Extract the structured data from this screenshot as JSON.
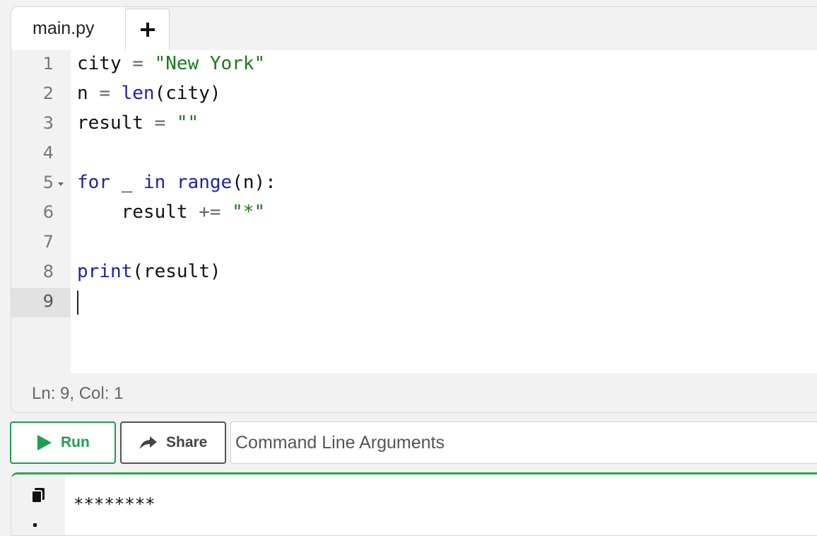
{
  "tabs": {
    "file_label": "main.py",
    "add_label": "+"
  },
  "editor": {
    "lines": [
      {
        "num": "1",
        "tokens": [
          {
            "t": "city ",
            "c": ""
          },
          {
            "t": "=",
            "c": "op"
          },
          {
            "t": " ",
            "c": ""
          },
          {
            "t": "\"New York\"",
            "c": "str"
          }
        ]
      },
      {
        "num": "2",
        "tokens": [
          {
            "t": "n ",
            "c": ""
          },
          {
            "t": "=",
            "c": "op"
          },
          {
            "t": " ",
            "c": ""
          },
          {
            "t": "len",
            "c": "fn"
          },
          {
            "t": "(city)",
            "c": ""
          }
        ]
      },
      {
        "num": "3",
        "tokens": [
          {
            "t": "result ",
            "c": ""
          },
          {
            "t": "=",
            "c": "op"
          },
          {
            "t": " ",
            "c": ""
          },
          {
            "t": "\"\"",
            "c": "str"
          }
        ]
      },
      {
        "num": "4",
        "tokens": []
      },
      {
        "num": "5",
        "fold": true,
        "tokens": [
          {
            "t": "for",
            "c": "kw"
          },
          {
            "t": " _ ",
            "c": ""
          },
          {
            "t": "in",
            "c": "kw"
          },
          {
            "t": " ",
            "c": ""
          },
          {
            "t": "range",
            "c": "fn"
          },
          {
            "t": "(n):",
            "c": ""
          }
        ]
      },
      {
        "num": "6",
        "tokens": [
          {
            "t": "    result ",
            "c": ""
          },
          {
            "t": "+=",
            "c": "op"
          },
          {
            "t": " ",
            "c": ""
          },
          {
            "t": "\"*\"",
            "c": "str"
          }
        ]
      },
      {
        "num": "7",
        "tokens": []
      },
      {
        "num": "8",
        "tokens": [
          {
            "t": "print",
            "c": "fn"
          },
          {
            "t": "(result)",
            "c": ""
          }
        ]
      },
      {
        "num": "9",
        "active": true,
        "tokens": []
      }
    ]
  },
  "status": {
    "position": "Ln: 9,  Col: 1"
  },
  "toolbar": {
    "run_label": "Run",
    "share_label": "Share",
    "args_placeholder": "Command Line Arguments"
  },
  "output": {
    "text": "********"
  },
  "colors": {
    "run_green": "#1f9d55",
    "keyword_blue": "#1e22aa",
    "string_green": "#1a7a1a"
  },
  "icons": {
    "run": "play-icon",
    "share": "share-arrow-icon",
    "copy": "copy-icon"
  }
}
